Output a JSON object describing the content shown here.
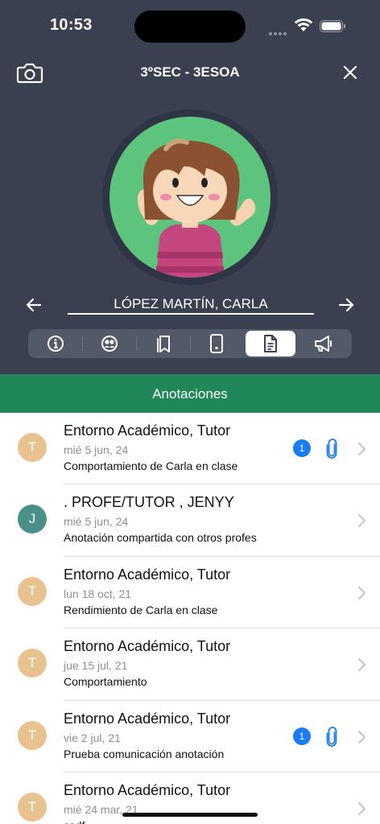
{
  "status_bar": {
    "time": "10:53"
  },
  "header": {
    "title": "3ºSEC - 3ESOA"
  },
  "student": {
    "name": "LÓPEZ MARTÍN, CARLA"
  },
  "tabs": [
    {
      "icon": "info-icon",
      "active": false
    },
    {
      "icon": "faces-icon",
      "active": false
    },
    {
      "icon": "bookmarks-icon",
      "active": false
    },
    {
      "icon": "phone-icon",
      "active": false
    },
    {
      "icon": "document-icon",
      "active": true
    },
    {
      "icon": "megaphone-icon",
      "active": false
    }
  ],
  "section": {
    "title": "Anotaciones"
  },
  "annotations": [
    {
      "initial": "T",
      "avatar_color": "#e8c28f",
      "author": "Entorno Académico, Tutor",
      "date": "mié 5 jun, 24",
      "subject": "Comportamiento de Carla en clase",
      "attachments": "1"
    },
    {
      "initial": "J",
      "avatar_color": "#4a8f8a",
      "author": ". PROFE/TUTOR , JENYY",
      "date": "mié 5 jun, 24",
      "subject": "Anotación compartida con otros profes",
      "attachments": null
    },
    {
      "initial": "T",
      "avatar_color": "#e8c28f",
      "author": "Entorno Académico, Tutor",
      "date": "lun 18 oct, 21",
      "subject": "Rendimiento de Carla en clase",
      "attachments": null
    },
    {
      "initial": "T",
      "avatar_color": "#e8c28f",
      "author": "Entorno Académico, Tutor",
      "date": "jue 15 jul, 21",
      "subject": "Comportamiento",
      "attachments": null
    },
    {
      "initial": "T",
      "avatar_color": "#e8c28f",
      "author": "Entorno Académico, Tutor",
      "date": "vie 2 jul, 21",
      "subject": "Prueba comunicación anotación",
      "attachments": "1"
    },
    {
      "initial": "T",
      "avatar_color": "#e8c28f",
      "author": "Entorno Académico, Tutor",
      "date": "mié 24 mar, 21",
      "subject": "sadf",
      "attachments": null
    }
  ],
  "colors": {
    "header_bg": "#3a4050",
    "section_bg": "#1f8758",
    "badge": "#1a7cf0",
    "accent": "#1a7cf0"
  }
}
